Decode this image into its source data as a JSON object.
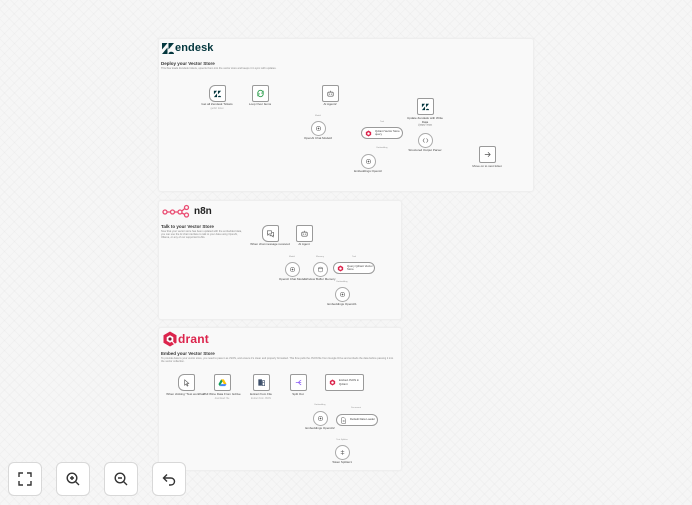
{
  "sections": {
    "zendesk": {
      "logo_text": "endesk",
      "title": "Deploy your Vector Store",
      "description": "This flow loads Zendesk tickets, upserts them into the vector store and keeps it in sync with updates.",
      "nodes": {
        "get_tickets": {
          "label": "Get all Zendesk Tickets",
          "sub": "getAll: ticket"
        },
        "loop_items": {
          "label": "Loop Over Items"
        },
        "ai_agent": {
          "label": "AI Agent2"
        },
        "update_ticket": {
          "label": "Update Zendesk with Write Data",
          "sub": "update: ticket"
        },
        "store_ticket": {
          "label": "Move on to next ticket"
        },
        "chat_model": {
          "label": "OpenAI Chat Model2"
        },
        "qdrant_store": {
          "label": "Qdrant Vector Store query"
        },
        "output_parser": {
          "label": "Structured Output Parser"
        },
        "embeddings": {
          "label": "Embeddings OpenAI"
        }
      },
      "connection_labels": {
        "model": "Model",
        "tool": "Tool",
        "embedding": "Embedding",
        "output_parser": "Output Parser"
      }
    },
    "n8n": {
      "logo_text": "n8n",
      "title": "Talk to your Vector Store",
      "description": "Now that your vector store has been updated with the embedded data, you can use the AI chat interface to talk to your data using OpenAI, Ollama, or any of our supported LLMs.",
      "nodes": {
        "chat_trigger": {
          "label": "When chat message received"
        },
        "ai_agent": {
          "label": "AI Agent"
        },
        "chat_model": {
          "label": "OpenAI Chat Model"
        },
        "memory": {
          "label": "Window Buffer Memory"
        },
        "qdrant_store": {
          "label": "Query Qdrant Vector Store"
        },
        "embeddings": {
          "label": "Embeddings OpenAI1"
        }
      },
      "connection_labels": {
        "model": "Model",
        "memory": "Memory",
        "tool": "Tool",
        "embedding": "Embedding"
      }
    },
    "qdrant": {
      "logo_text": "drant",
      "title": "Embed your Vector Store",
      "description": "To provide data to your vector store, you need to pass it as JSON, and ensure it's clean and properly formatted. This flow pulls the JSON file from Google Drive and embeds the data before passing it into the vector collection.",
      "nodes": {
        "manual_trigger": {
          "label": "When clicking \"Test workflow\""
        },
        "gdrive": {
          "label": "Pull Wine Data From Gdrive",
          "sub": "download: file"
        },
        "extract": {
          "label": "Extract from File",
          "sub": "Extract from JSON"
        },
        "split": {
          "label": "Split Out"
        },
        "qdrant_insert": {
          "label": "Embed JSON in Qdrant"
        },
        "embeddings": {
          "label": "Embeddings OpenAI2"
        },
        "loader": {
          "label": "Default Data Loader"
        },
        "splitter": {
          "label": "Token Splitter1"
        }
      },
      "connection_labels": {
        "embedding": "Embedding",
        "document": "Document",
        "text_splitter": "Text Splitter"
      }
    }
  },
  "controls": {
    "fit_view": {
      "icon": "fit-view-icon"
    },
    "zoom_in": {
      "icon": "zoom-in-icon"
    },
    "zoom_out": {
      "icon": "zoom-out-icon"
    },
    "undo": {
      "icon": "undo-icon"
    }
  },
  "colors": {
    "zendesk_brand": "#03363d",
    "n8n_brand": "#ea4b71",
    "qdrant_brand": "#dc244c",
    "node_border": "#9a9a9a",
    "wire": "#b0b0b0"
  }
}
